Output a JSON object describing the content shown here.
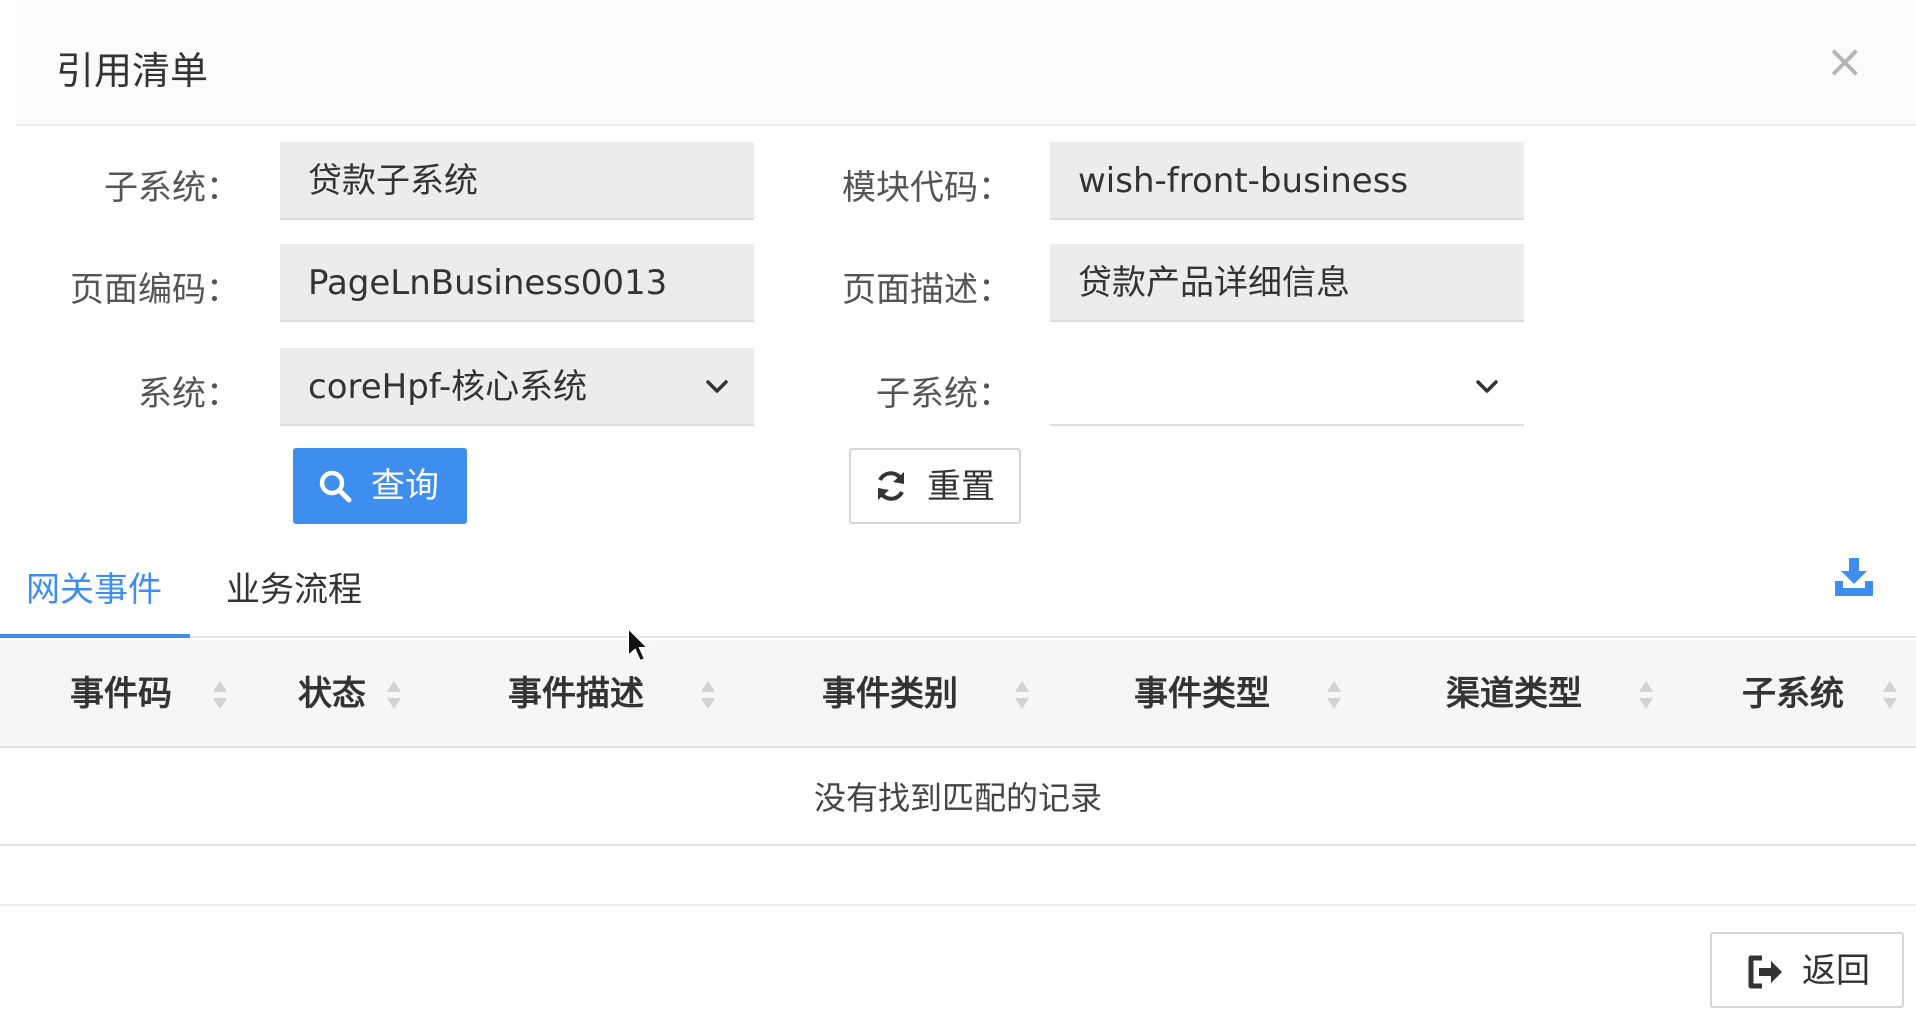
{
  "dialog": {
    "title": "引用清单",
    "close_glyph": "×"
  },
  "form": {
    "subsystem": {
      "label": "子系统：",
      "value": "贷款子系统"
    },
    "module_code": {
      "label": "模块代码：",
      "value": "wish-front-business"
    },
    "page_code": {
      "label": "页面编码：",
      "value": "PageLnBusiness0013"
    },
    "page_desc": {
      "label": "页面描述：",
      "value": "贷款产品详细信息"
    },
    "system": {
      "label": "系统：",
      "value": "coreHpf-核心系统"
    },
    "subsystem_select": {
      "label": "子系统：",
      "value": ""
    }
  },
  "buttons": {
    "query": "查询",
    "reset": "重置",
    "back": "返回"
  },
  "tabs": [
    {
      "label": "网关事件",
      "active": true
    },
    {
      "label": "业务流程",
      "active": false
    }
  ],
  "table": {
    "columns": [
      "事件码",
      "状态",
      "事件描述",
      "事件类别",
      "事件类型",
      "渠道类型",
      "子系统"
    ],
    "empty_text": "没有找到匹配的记录"
  },
  "colors": {
    "primary": "#3e8ef0",
    "field_bg": "#ececec",
    "header_bg": "#f6f6f6"
  },
  "icons": [
    "close-icon",
    "chevron-down-icon",
    "search-icon",
    "refresh-icon",
    "download-icon",
    "sort-icon",
    "sign-out-icon",
    "mouse-cursor-icon"
  ]
}
